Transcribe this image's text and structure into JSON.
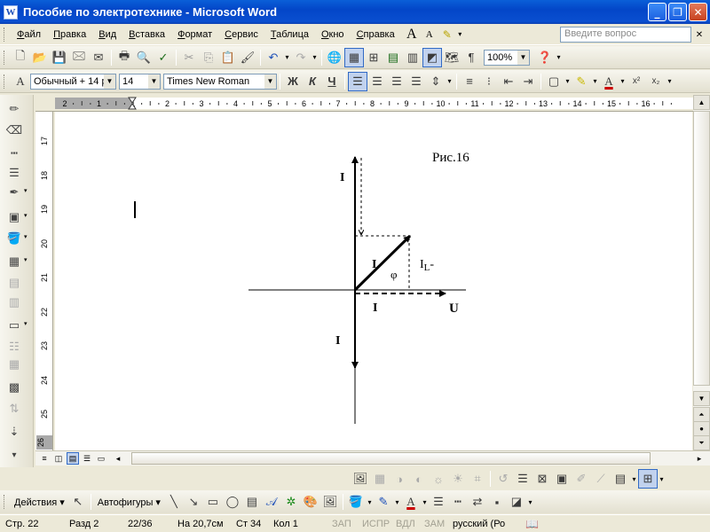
{
  "window": {
    "title": "Пособие по электротехнике - Microsoft Word",
    "app_icon": "W",
    "controls": [
      "_",
      "❐",
      "✕"
    ]
  },
  "menu": {
    "items": [
      "Файл",
      "Правка",
      "Вид",
      "Вставка",
      "Формат",
      "Сервис",
      "Таблица",
      "Окно",
      "Справка"
    ],
    "ask_placeholder": "Введите вопрос"
  },
  "standard_toolbar": {
    "zoom": "100%"
  },
  "formatting_toolbar": {
    "style": "Обычный + 14 р",
    "size": "14",
    "font": "Times New Roman",
    "bold": "Ж",
    "italic": "К",
    "underline": "Ч"
  },
  "rulers": {
    "horizontal_ticks": [
      "2",
      "1",
      "1",
      "2",
      "3",
      "4",
      "5",
      "6",
      "7",
      "8",
      "9",
      "10",
      "11",
      "12",
      "13",
      "14",
      "15",
      "16"
    ],
    "vertical_ticks": [
      "17",
      "18",
      "19",
      "20",
      "21",
      "22",
      "23",
      "24",
      "25"
    ],
    "vertical_bottom": "26"
  },
  "document": {
    "figure": {
      "caption": "Рис.16",
      "labels": {
        "i_top": "I",
        "i_diag": "I",
        "phi": "φ",
        "il": "I",
        "il_sub": "L",
        "il_suffix": "-",
        "i_horiz": "I",
        "u": "U",
        "i_bottom": "I"
      }
    }
  },
  "draw_toolbar": {
    "actions": "Действия",
    "autoshapes": "Автофигуры"
  },
  "status": {
    "page": "Стр.  22",
    "section": "Разд  2",
    "pages": "22/36",
    "at": "На 20,7см",
    "line": "Ст  34",
    "col": "Кол  1",
    "rec": "ЗАП",
    "trk": "ИСПР",
    "ext": "ВДЛ",
    "ovr": "ЗАМ",
    "language": "русский (Ро"
  }
}
